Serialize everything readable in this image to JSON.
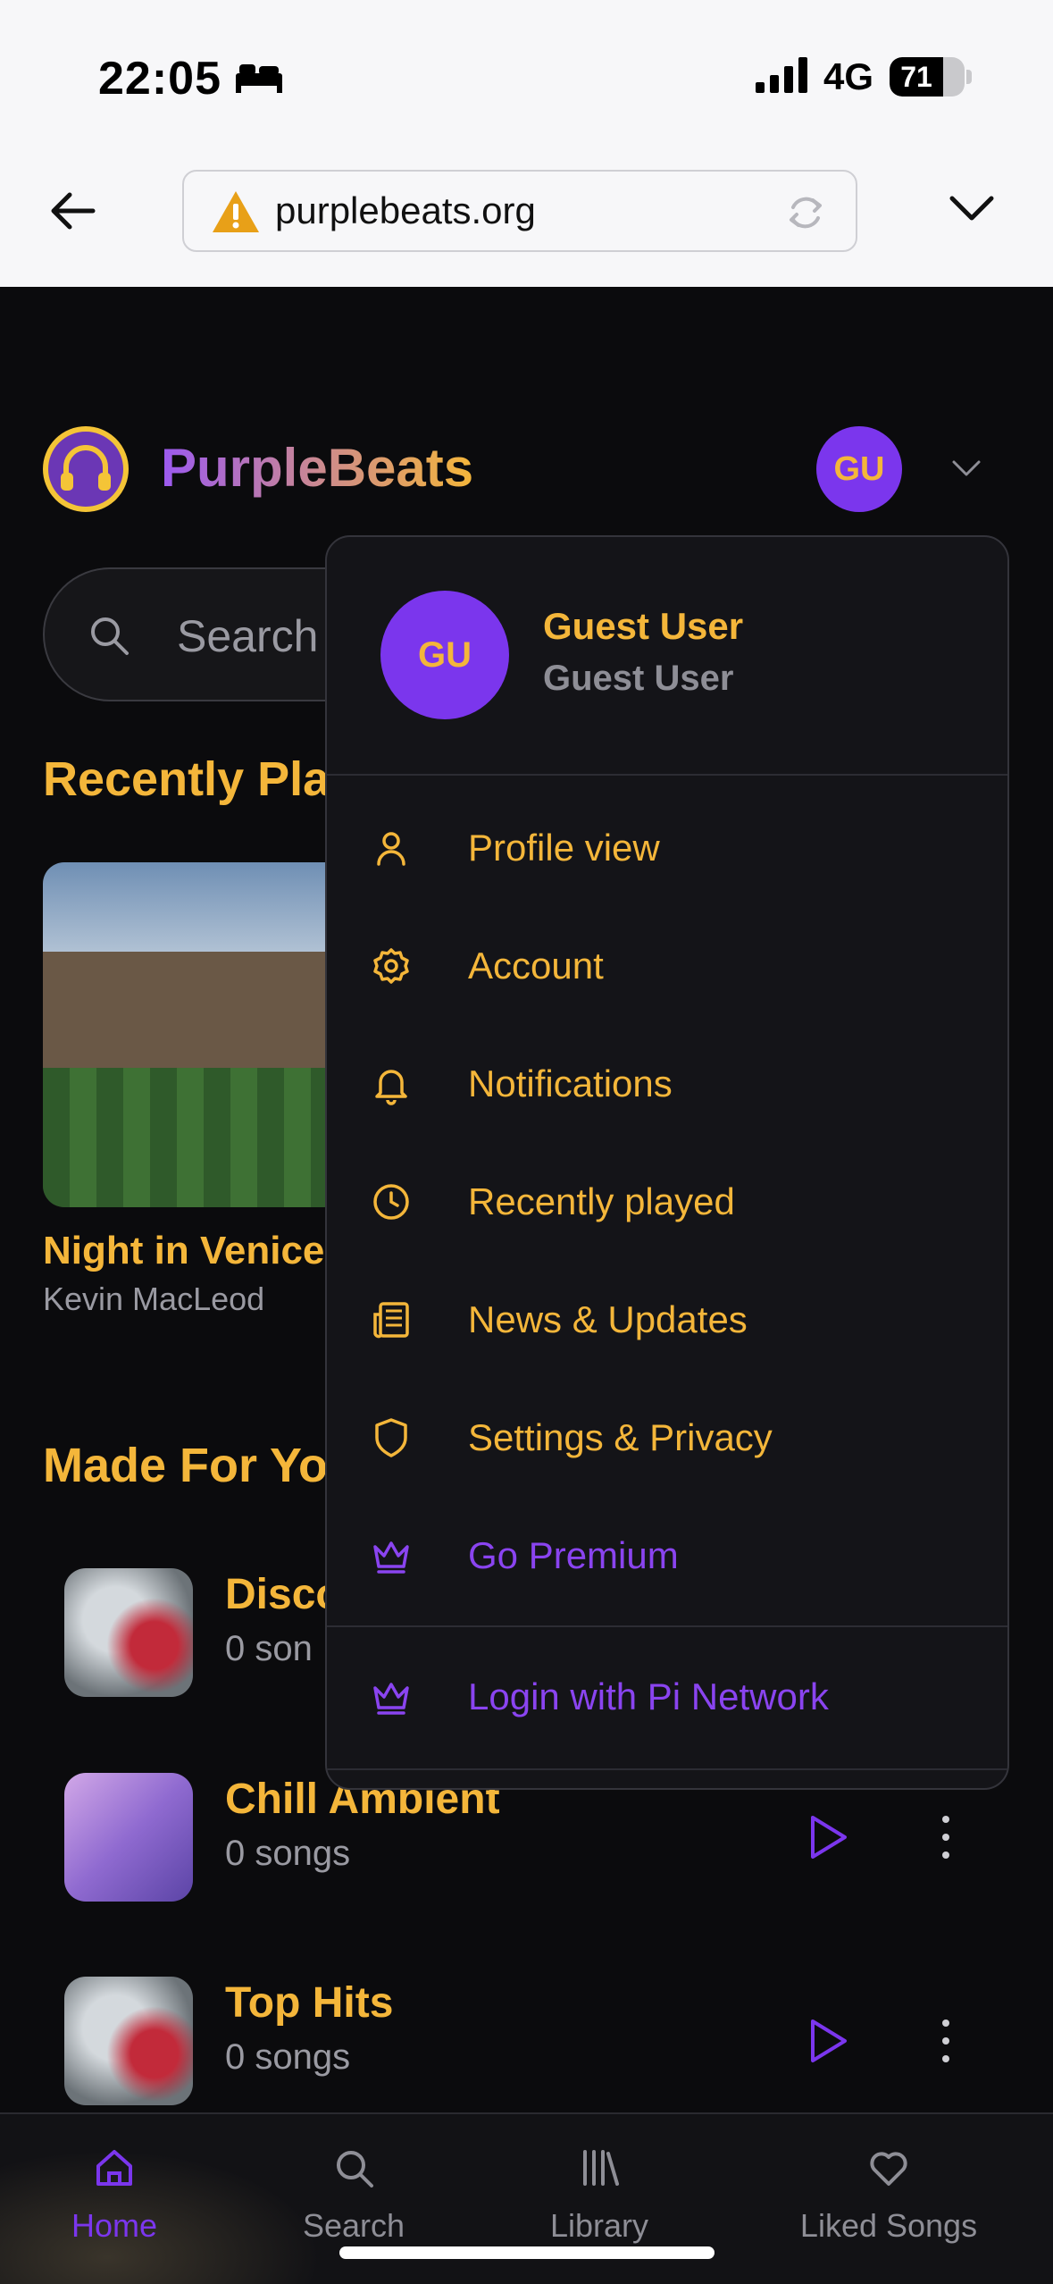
{
  "status_bar": {
    "time": "22:05",
    "network": "4G",
    "battery": "71",
    "battery_level": 71
  },
  "browser": {
    "url": "purplebeats.org"
  },
  "app": {
    "brand": "PurpleBeats",
    "avatar_initials": "GU",
    "search_placeholder": "Search",
    "recently_played": {
      "heading": "Recently Pla",
      "items": [
        {
          "title": "Night in Venice",
          "artist": "Kevin MacLeod"
        }
      ]
    },
    "made_for_you": {
      "heading": "Made For Yo",
      "items": [
        {
          "title": "Disco",
          "subtitle": "0 son"
        },
        {
          "title": "Chill Ambient",
          "subtitle": "0 songs"
        },
        {
          "title": "Top Hits",
          "subtitle": "0 songs"
        }
      ]
    }
  },
  "menu": {
    "avatar_initials": "GU",
    "name": "Guest User",
    "subtitle": "Guest User",
    "items": [
      {
        "label": "Profile view",
        "icon": "user-icon"
      },
      {
        "label": "Account",
        "icon": "gear-icon"
      },
      {
        "label": "Notifications",
        "icon": "bell-icon"
      },
      {
        "label": "Recently played",
        "icon": "clock-icon"
      },
      {
        "label": "News & Updates",
        "icon": "newspaper-icon"
      },
      {
        "label": "Settings & Privacy",
        "icon": "shield-icon"
      },
      {
        "label": "Go Premium",
        "icon": "crown-icon"
      }
    ],
    "login_label": "Login with Pi Network"
  },
  "bottom_nav": [
    {
      "label": "Home",
      "icon": "home-icon",
      "active": true
    },
    {
      "label": "Search",
      "icon": "search-icon"
    },
    {
      "label": "Library",
      "icon": "library-icon"
    },
    {
      "label": "Liked Songs",
      "icon": "heart-icon"
    }
  ],
  "colors": {
    "accent_gold": "#f4b63a",
    "accent_purple": "#7b36ed",
    "background": "#0b0b0d",
    "menu_bg": "#141418"
  }
}
